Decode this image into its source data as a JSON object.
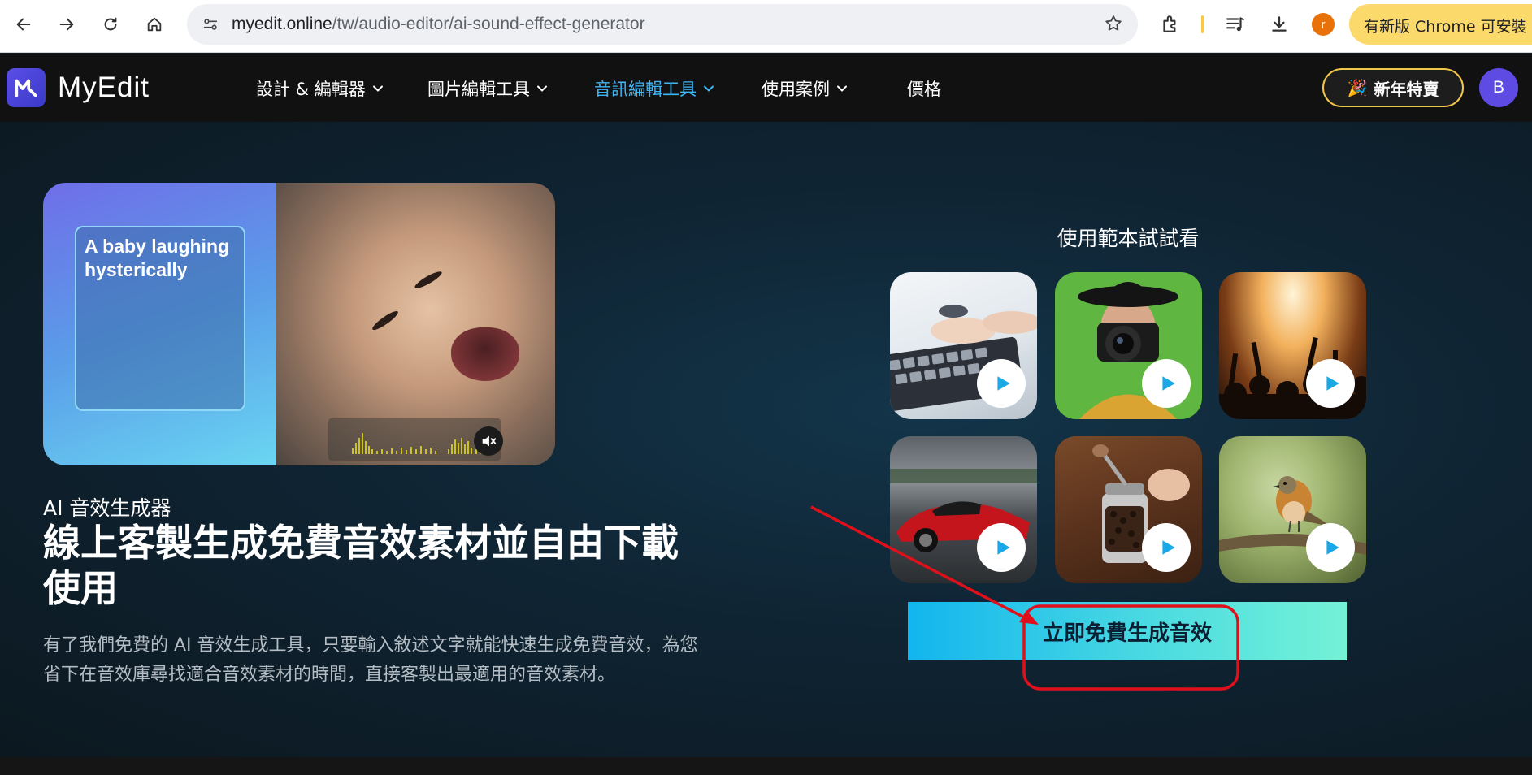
{
  "browser": {
    "url_host": "myedit.online",
    "url_path": "/tw/audio-editor/ai-sound-effect-generator",
    "profile_initial": "r",
    "update_label": "有新版 Chrome 可安裝"
  },
  "site": {
    "logo_text": "MyEdit",
    "menu": [
      {
        "label": "設計 & 編輯器"
      },
      {
        "label": "圖片編輯工具"
      },
      {
        "label": "音訊編輯工具"
      },
      {
        "label": "使用案例"
      },
      {
        "label": "價格"
      }
    ],
    "promo_label": "新年特賣",
    "avatar_initial": "B",
    "accent_color": "#3eb6f5"
  },
  "hero": {
    "demo_prompt": "A baby laughing hysterically",
    "eyebrow": "AI 音效生成器",
    "headline": "線上客製生成免費音效素材並自由下載使用",
    "description": "有了我們免費的 AI 音效生成工具，只要輸入敘述文字就能快速生成免費音效，為您省下在音效庫尋找適合音效素材的時間，直接客製出最適用的音效素材。",
    "samples_title": "使用範本試試看",
    "cta_label": "立即免費生成音效"
  }
}
